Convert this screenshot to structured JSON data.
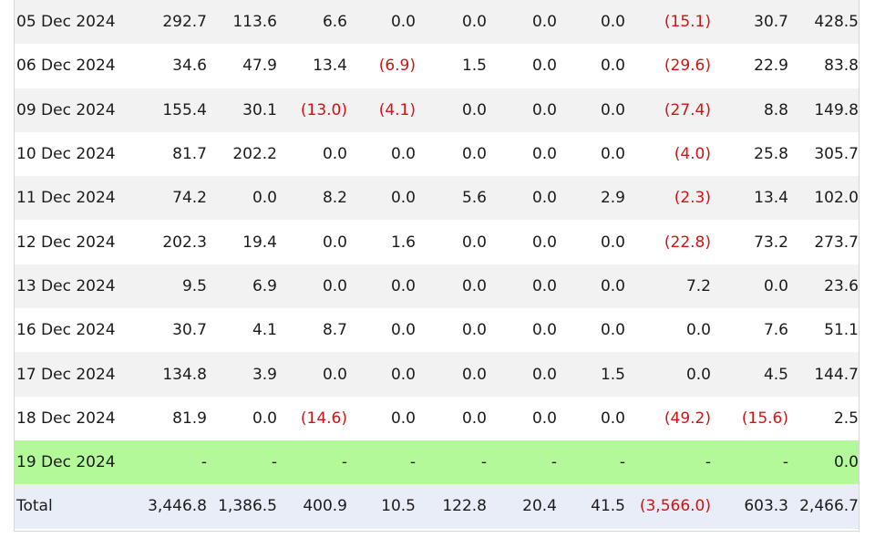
{
  "colors": {
    "negative": "#d01414",
    "highlight_row": "#b3f99a",
    "total_row": "#e9edf7",
    "stripe": "#f2f2f2"
  },
  "rows": [
    {
      "date": "05 Dec 2024",
      "values": [
        "292.7",
        "113.6",
        "6.6",
        "0.0",
        "0.0",
        "0.0",
        "0.0",
        "(15.1)",
        "30.7",
        "428.5"
      ]
    },
    {
      "date": "06 Dec 2024",
      "values": [
        "34.6",
        "47.9",
        "13.4",
        "(6.9)",
        "1.5",
        "0.0",
        "0.0",
        "(29.6)",
        "22.9",
        "83.8"
      ]
    },
    {
      "date": "09 Dec 2024",
      "values": [
        "155.4",
        "30.1",
        "(13.0)",
        "(4.1)",
        "0.0",
        "0.0",
        "0.0",
        "(27.4)",
        "8.8",
        "149.8"
      ]
    },
    {
      "date": "10 Dec 2024",
      "values": [
        "81.7",
        "202.2",
        "0.0",
        "0.0",
        "0.0",
        "0.0",
        "0.0",
        "(4.0)",
        "25.8",
        "305.7"
      ]
    },
    {
      "date": "11 Dec 2024",
      "values": [
        "74.2",
        "0.0",
        "8.2",
        "0.0",
        "5.6",
        "0.0",
        "2.9",
        "(2.3)",
        "13.4",
        "102.0"
      ]
    },
    {
      "date": "12 Dec 2024",
      "values": [
        "202.3",
        "19.4",
        "0.0",
        "1.6",
        "0.0",
        "0.0",
        "0.0",
        "(22.8)",
        "73.2",
        "273.7"
      ]
    },
    {
      "date": "13 Dec 2024",
      "values": [
        "9.5",
        "6.9",
        "0.0",
        "0.0",
        "0.0",
        "0.0",
        "0.0",
        "7.2",
        "0.0",
        "23.6"
      ]
    },
    {
      "date": "16 Dec 2024",
      "values": [
        "30.7",
        "4.1",
        "8.7",
        "0.0",
        "0.0",
        "0.0",
        "0.0",
        "0.0",
        "7.6",
        "51.1"
      ]
    },
    {
      "date": "17 Dec 2024",
      "values": [
        "134.8",
        "3.9",
        "0.0",
        "0.0",
        "0.0",
        "0.0",
        "1.5",
        "0.0",
        "4.5",
        "144.7"
      ]
    },
    {
      "date": "18 Dec 2024",
      "values": [
        "81.9",
        "0.0",
        "(14.6)",
        "0.0",
        "0.0",
        "0.0",
        "0.0",
        "(49.2)",
        "(15.6)",
        "2.5"
      ]
    },
    {
      "date": "19 Dec 2024",
      "values": [
        "-",
        "-",
        "-",
        "-",
        "-",
        "-",
        "-",
        "-",
        "-",
        "0.0"
      ]
    }
  ],
  "total": {
    "label": "Total",
    "values": [
      "3,446.8",
      "1,386.5",
      "400.9",
      "10.5",
      "122.8",
      "20.4",
      "41.5",
      "(3,566.0)",
      "603.3",
      "2,466.7"
    ]
  }
}
